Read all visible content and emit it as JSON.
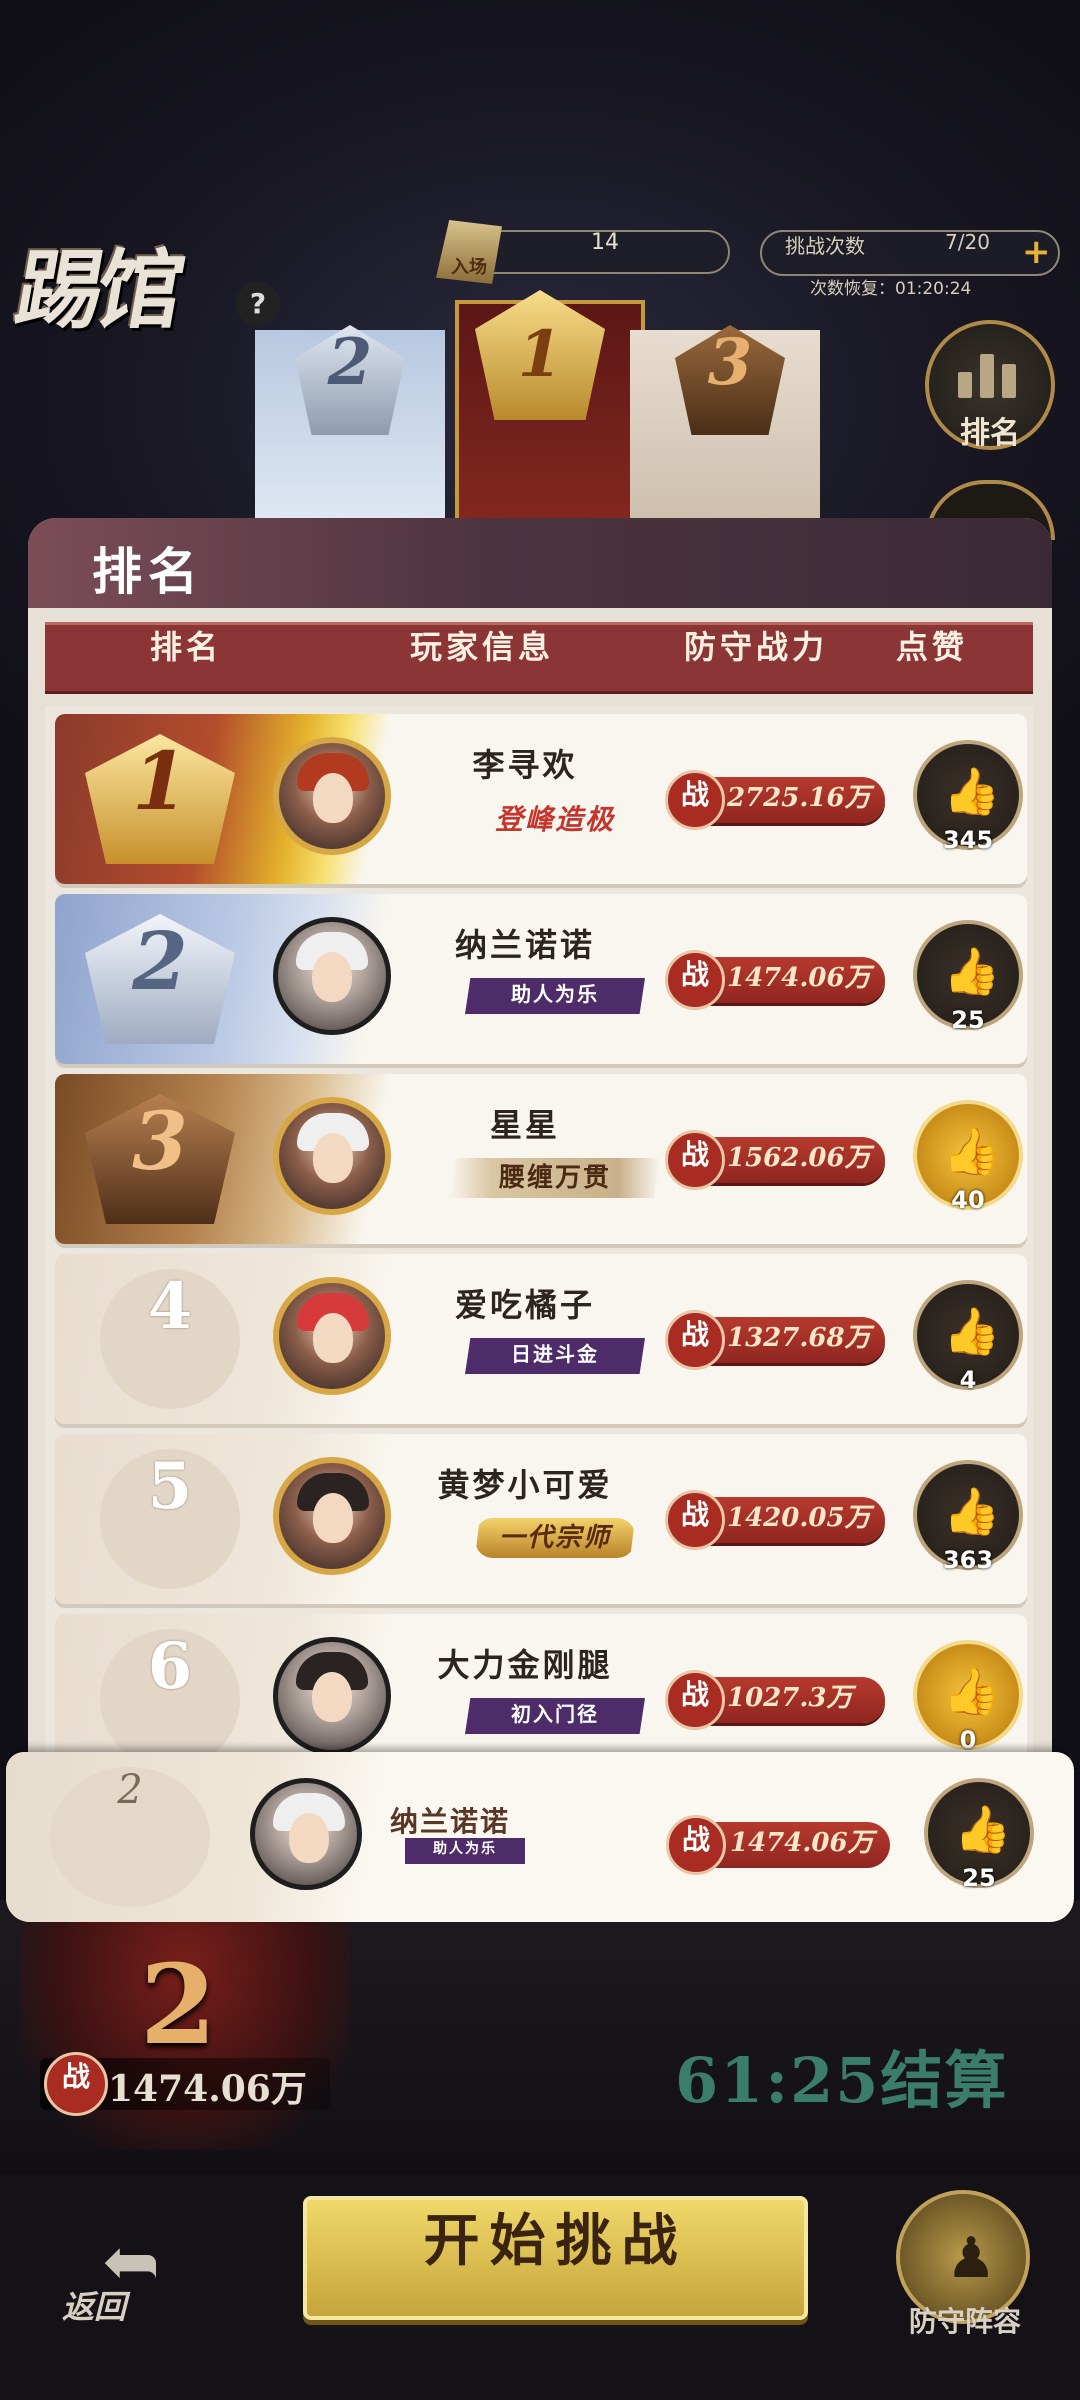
{
  "header": {
    "logo": "踢馆",
    "help": "?",
    "points_icon_label": "入场",
    "points_value": "14",
    "challenge_label": "挑战次数",
    "challenge_value": "7/20",
    "challenge_plus": "+",
    "recover_text": "次数恢复：01:20:24"
  },
  "podium": {
    "first": "1",
    "second": "2",
    "third": "3"
  },
  "side": {
    "rank_button_label": "排名"
  },
  "panel": {
    "title": "排名",
    "columns": {
      "rank": "排名",
      "info": "玩家信息",
      "power": "防守战力",
      "like": "点赞"
    },
    "rows": [
      {
        "rank": "1",
        "name": "李寻欢",
        "title": "登峰造极",
        "zhan": "战",
        "power": "2725.16万",
        "likes": "345"
      },
      {
        "rank": "2",
        "name": "纳兰诺诺",
        "title": "助人为乐",
        "zhan": "战",
        "power": "1474.06万",
        "likes": "25"
      },
      {
        "rank": "3",
        "name": "星星",
        "title": "腰缠万贯",
        "zhan": "战",
        "power": "1562.06万",
        "likes": "40"
      },
      {
        "rank": "4",
        "name": "爱吃橘子",
        "title": "日进斗金",
        "zhan": "战",
        "power": "1327.68万",
        "likes": "4"
      },
      {
        "rank": "5",
        "name": "黄梦小可爱",
        "title": "一代宗师",
        "zhan": "战",
        "power": "1420.05万",
        "likes": "363"
      },
      {
        "rank": "6",
        "name": "大力金刚腿",
        "title": "初入门径",
        "zhan": "战",
        "power": "1027.3万",
        "likes": "0"
      }
    ],
    "my_row": {
      "rank": "2",
      "name": "纳兰诺诺",
      "title": "助人为乐",
      "zhan": "战",
      "power": "1474.06万",
      "likes": "25"
    }
  },
  "scene": {
    "my_rank_big": "2",
    "my_power": "1474.06万",
    "zhan": "战",
    "settle_text": "61:25结算"
  },
  "bottom": {
    "back_label": "返回",
    "start_label": "开始挑战",
    "defense_label": "防守阵容"
  },
  "icons": {
    "like": "thumbs-up-icon",
    "back": "back-arrow-icon",
    "defense": "defense-lineup-icon",
    "rank": "rank-bars-icon"
  },
  "colors": {
    "accent_red": "#8b3537",
    "gold": "#e8b23a",
    "settle_green": "#3a7d6a"
  }
}
